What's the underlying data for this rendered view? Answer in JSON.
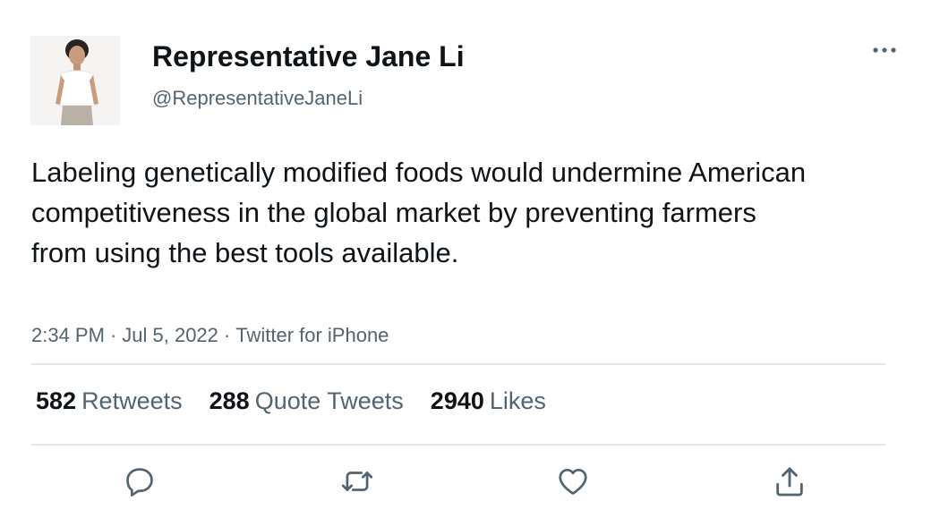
{
  "author": {
    "display_name": "Representative Jane Li",
    "handle": "@RepresentativeJaneLi"
  },
  "tweet": {
    "text": "Labeling genetically modified foods would undermine American competitiveness in the global market by preventing farmers from using the best tools available.",
    "time": "2:34 PM",
    "date": "Jul 5, 2022",
    "source": "Twitter for iPhone",
    "separator": "·"
  },
  "stats": {
    "retweets": {
      "count": "582",
      "label": "Retweets"
    },
    "quotes": {
      "count": "288",
      "label": "Quote Tweets"
    },
    "likes": {
      "count": "2940",
      "label": "Likes"
    }
  },
  "icons": {
    "more": "more-horizontal-icon",
    "reply": "reply-icon",
    "retweet": "retweet-icon",
    "like": "heart-icon",
    "share": "share-icon"
  },
  "colors": {
    "text_primary": "#0f1419",
    "text_secondary": "#536471",
    "divider": "#e3e6e8"
  }
}
